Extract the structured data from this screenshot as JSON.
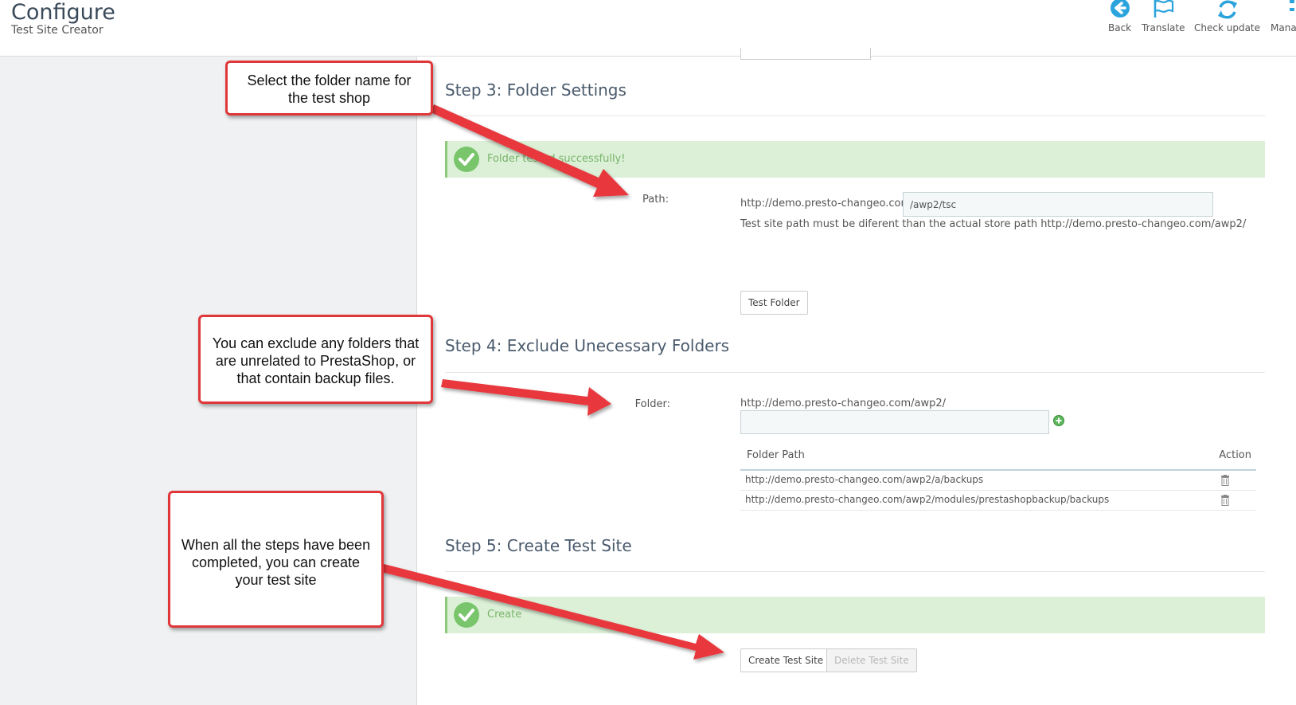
{
  "header": {
    "title": "Configure",
    "subtitle": "Test Site Creator",
    "toolbar": [
      {
        "label": "Back",
        "icon": "back-arrow-icon"
      },
      {
        "label": "Translate",
        "icon": "flag-icon"
      },
      {
        "label": "Check update",
        "icon": "refresh-icon"
      },
      {
        "label": "Mana",
        "icon": "manage-icon"
      }
    ]
  },
  "step3": {
    "title": "Step 3: Folder Settings",
    "alert": "Folder tested successfully!",
    "path_label": "Path:",
    "path_prefix": "http://demo.presto-changeo.com",
    "path_value": "/awp2/tsc",
    "help": "Test site path must be diferent than the actual store path http://demo.presto-changeo.com/awp2/",
    "test_button": "Test Folder"
  },
  "step4": {
    "title": "Step 4: Exclude Unecessary Folders",
    "folder_label": "Folder:",
    "folder_prefix": "http://demo.presto-changeo.com/awp2/",
    "folder_value": "",
    "table": {
      "headers": [
        "Folder Path",
        "Action"
      ],
      "rows": [
        "http://demo.presto-changeo.com/awp2/a/backups",
        "http://demo.presto-changeo.com/awp2/modules/prestashopbackup/backups"
      ]
    }
  },
  "step5": {
    "title": "Step 5: Create Test Site",
    "alert": "Create",
    "create_button": "Create Test Site",
    "delete_button": "Delete Test Site"
  },
  "callouts": {
    "c1": [
      "Select the folder name for",
      "the test shop"
    ],
    "c2": [
      "You can exclude any folders that",
      "are unrelated to PrestaShop, or",
      "that contain backup files."
    ],
    "c3": [
      "When all the steps have been",
      "completed, you can create",
      "your test site"
    ]
  },
  "colors": {
    "accent": "#2ba3dc",
    "success_bg": "#dcf0d7",
    "success_icon": "#79c56b",
    "callout_border": "#e0373a"
  }
}
